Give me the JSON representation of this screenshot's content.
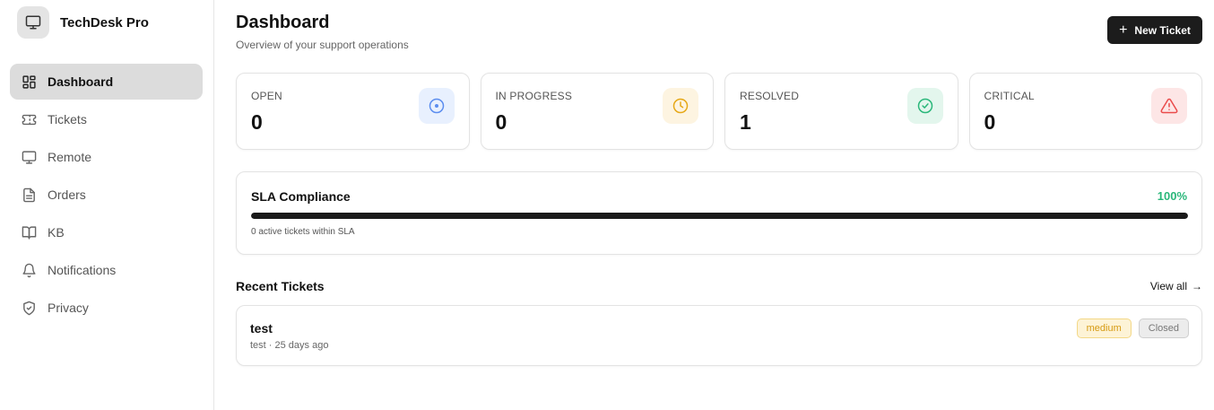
{
  "brand": {
    "name": "TechDesk Pro",
    "icon": "monitor-icon"
  },
  "sidebar": {
    "items": [
      {
        "label": "Dashboard",
        "icon": "layout-grid-icon",
        "active": true
      },
      {
        "label": "Tickets",
        "icon": "ticket-icon",
        "active": false
      },
      {
        "label": "Remote",
        "icon": "monitor-icon",
        "active": false
      },
      {
        "label": "Orders",
        "icon": "file-text-icon",
        "active": false
      },
      {
        "label": "KB",
        "icon": "book-open-icon",
        "active": false
      },
      {
        "label": "Notifications",
        "icon": "bell-icon",
        "active": false
      },
      {
        "label": "Privacy",
        "icon": "shield-check-icon",
        "active": false
      }
    ]
  },
  "header": {
    "title": "Dashboard",
    "subtitle": "Overview of your support operations",
    "new_ticket_label": "New Ticket"
  },
  "stats": [
    {
      "label": "OPEN",
      "value": "0",
      "icon": "circle-dot-icon",
      "color": "#5b8def",
      "bg": "#e8f0fe"
    },
    {
      "label": "IN PROGRESS",
      "value": "0",
      "icon": "clock-icon",
      "color": "#e6a817",
      "bg": "#fdf4e1"
    },
    {
      "label": "RESOLVED",
      "value": "1",
      "icon": "check-circle-icon",
      "color": "#2ab77a",
      "bg": "#e3f6ed"
    },
    {
      "label": "CRITICAL",
      "value": "0",
      "icon": "alert-triangle-icon",
      "color": "#ea4b4b",
      "bg": "#fde6e6"
    }
  ],
  "sla": {
    "title": "SLA Compliance",
    "percent": "100%",
    "progress": 1.0,
    "note": "0 active tickets within SLA",
    "accent": "#2ab77a"
  },
  "recent": {
    "title": "Recent Tickets",
    "view_all_label": "View all",
    "tickets": [
      {
        "title": "test",
        "meta": "test · 25 days ago",
        "priority": "medium",
        "status": "Closed"
      }
    ]
  }
}
